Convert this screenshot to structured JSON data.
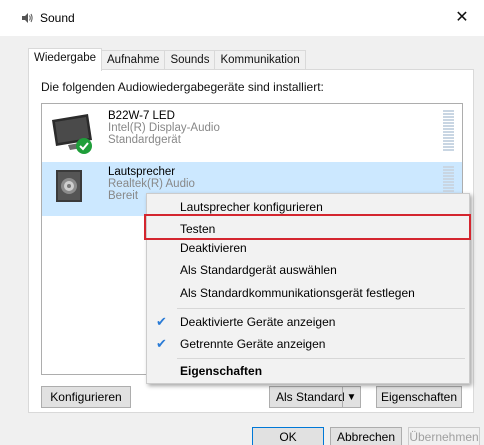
{
  "window": {
    "title": "Sound",
    "close_glyph": "✕"
  },
  "tabs": [
    {
      "label": "Wiedergabe",
      "active": true
    },
    {
      "label": "Aufnahme",
      "active": false
    },
    {
      "label": "Sounds",
      "active": false
    },
    {
      "label": "Kommunikation",
      "active": false
    }
  ],
  "panel": {
    "heading": "Die folgenden Audiowiedergabegeräte sind installiert:"
  },
  "devices": [
    {
      "name": "B22W-7 LED",
      "line2": "Intel(R) Display-Audio",
      "line3": "Standardgerät",
      "icon": "monitor-icon",
      "badge": "default-check-badge",
      "selected": false
    },
    {
      "name": "Lautsprecher",
      "line2": "Realtek(R) Audio",
      "line3": "Bereit",
      "icon": "speaker-icon",
      "selected": true
    }
  ],
  "buttons": {
    "configure": "Konfigurieren",
    "set_default": "Als Standard",
    "set_default_arrow": "▼",
    "properties": "Eigenschaften",
    "ok": "OK",
    "cancel": "Abbrechen",
    "apply": "Übernehmen"
  },
  "context_menu": {
    "items": [
      {
        "label": "Lautsprecher konfigurieren"
      },
      {
        "label": "Testen",
        "highlighted": true
      },
      {
        "label": "Deaktivieren"
      },
      {
        "label": "Als Standardgerät auswählen"
      },
      {
        "label": "Als Standardkommunikationsgerät festlegen"
      },
      {
        "label": "Deaktivierte Geräte anzeigen",
        "checked": true
      },
      {
        "label": "Getrennte Geräte anzeigen",
        "checked": true
      },
      {
        "label": "Eigenschaften",
        "bold": true
      }
    ],
    "check_glyph": "✔"
  },
  "colors": {
    "selection": "#cce8ff",
    "highlight_frame": "#d4262f",
    "check_mark": "#2a7bd6",
    "default_badge": "#1f9e3a"
  }
}
